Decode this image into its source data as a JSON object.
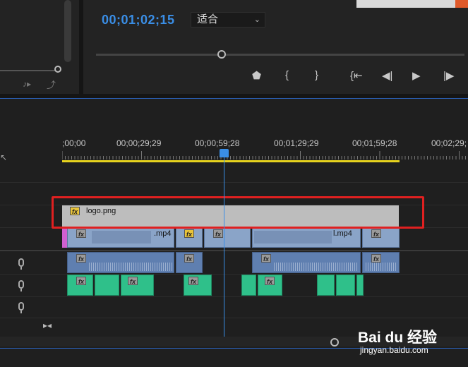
{
  "monitor": {
    "timecode": "00;01;02;15",
    "fit_select": "适合",
    "scrub_progress": 0.34
  },
  "ruler": {
    "labels": [
      ";00;00",
      "00;00;29;29",
      "00;00;59;28",
      "00;01;29;29",
      "00;01;59;28",
      "00;02;29;"
    ]
  },
  "tracks": {
    "graphic_clip_label": "logo.png",
    "video_clip_suffix_a": ".mp4",
    "video_clip_suffix_b": "l.mp4",
    "fx_label": "fx"
  },
  "watermark": {
    "brand": "Bai du 经验",
    "url": "jingyan.baidu.com"
  },
  "colors": {
    "accent_blue": "#3a8ee6",
    "work_area_yellow": "#e7d31e",
    "highlight_red": "#e02020",
    "audio_green": "#2fc08a",
    "video_blue": "#8aa4c8"
  }
}
